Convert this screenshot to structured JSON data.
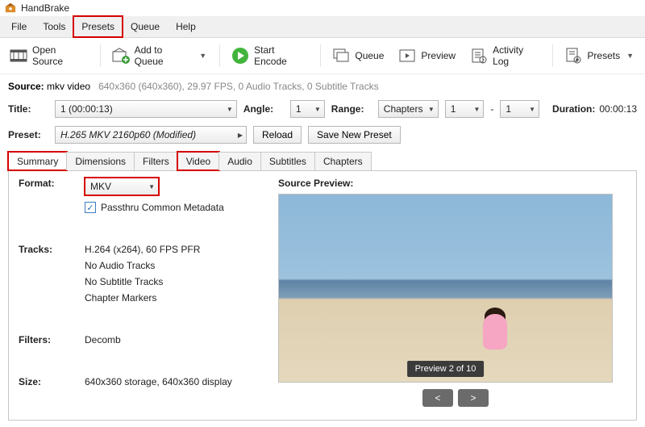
{
  "title": "HandBrake",
  "menubar": [
    "File",
    "Tools",
    "Presets",
    "Queue",
    "Help"
  ],
  "toolbar": {
    "open_source": "Open Source",
    "add_queue": "Add to Queue",
    "start_encode": "Start Encode",
    "queue": "Queue",
    "preview": "Preview",
    "activity_log": "Activity Log",
    "presets": "Presets"
  },
  "source": {
    "label": "Source:",
    "name": "mkv video",
    "details": "640x360 (640x360), 29.97 FPS, 0 Audio Tracks, 0 Subtitle Tracks"
  },
  "title_row": {
    "label": "Title:",
    "value": "1  (00:00:13)",
    "angle_label": "Angle:",
    "angle": "1",
    "range_label": "Range:",
    "range_type": "Chapters",
    "range_from": "1",
    "range_sep": "-",
    "range_to": "1",
    "duration_label": "Duration:",
    "duration": "00:00:13"
  },
  "preset": {
    "label": "Preset:",
    "value": "H.265 MKV 2160p60  (Modified)",
    "reload": "Reload",
    "save_new": "Save New Preset"
  },
  "tabs": [
    "Summary",
    "Dimensions",
    "Filters",
    "Video",
    "Audio",
    "Subtitles",
    "Chapters"
  ],
  "summary": {
    "format_label": "Format:",
    "format_value": "MKV",
    "passthru": "Passthru Common Metadata",
    "tracks_label": "Tracks:",
    "tracks": [
      "H.264 (x264), 60 FPS PFR",
      "No Audio Tracks",
      "No Subtitle Tracks",
      "Chapter Markers"
    ],
    "filters_label": "Filters:",
    "filters_value": "Decomb",
    "size_label": "Size:",
    "size_value": "640x360 storage, 640x360 display"
  },
  "preview": {
    "title": "Source Preview:",
    "badge": "Preview 2 of 10",
    "prev": "<",
    "next": ">"
  }
}
